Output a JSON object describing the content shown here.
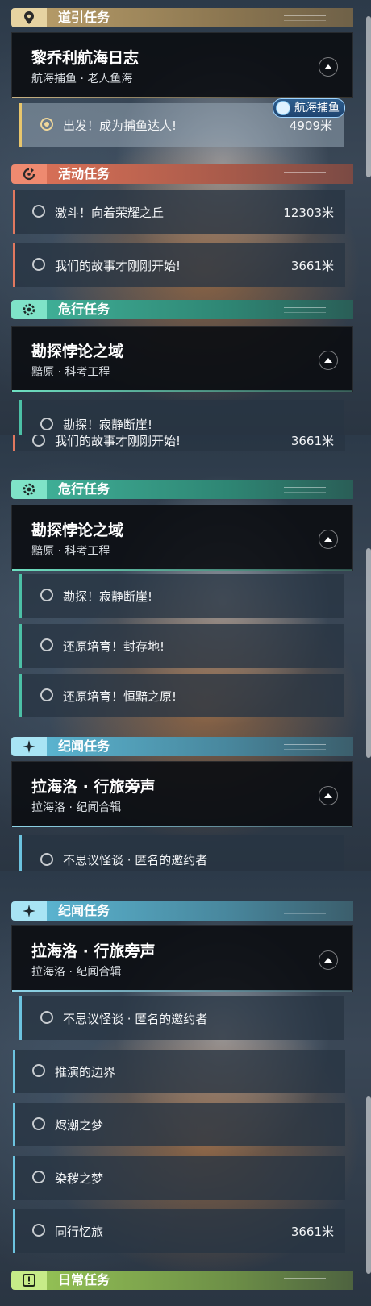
{
  "colors": {
    "guide": "#c9b383",
    "activity": "#e1785f",
    "danger": "#4cc0a6",
    "chronicle": "#6cc3df",
    "daily": "#a8d06a"
  },
  "panel1": {
    "guide": {
      "icon": "map-pin-icon",
      "label": "道引任务",
      "group_title": "黎乔利航海日志",
      "group_sub": "航海捕鱼 · 老人鱼海",
      "tag": "航海捕鱼",
      "task": {
        "name": "出发！成为捕鱼达人!",
        "dist": "4909米"
      }
    },
    "activity": {
      "icon": "refresh-icon",
      "label": "活动任务",
      "tasks": [
        {
          "name": "激斗！向着荣耀之丘",
          "dist": "12303米"
        },
        {
          "name": "我们的故事才刚刚开始!",
          "dist": "3661米"
        }
      ]
    },
    "danger": {
      "icon": "gear-eye-icon",
      "label": "危行任务",
      "group_title": "勘探悖论之域",
      "group_sub": "黯原 · 科考工程",
      "cut_task": "勘探！寂静断崖!"
    }
  },
  "panel2": {
    "cut_task": {
      "name": "我们的故事才刚刚开始!",
      "dist": "3661米"
    },
    "danger": {
      "label": "危行任务",
      "group_title": "勘探悖论之域",
      "group_sub": "黯原 · 科考工程",
      "tasks": [
        {
          "name": "勘探！寂静断崖!"
        },
        {
          "name": "还原培育！封存地!"
        },
        {
          "name": "还原培育！恒黯之原!"
        }
      ]
    },
    "chronicle": {
      "icon": "sparkle-icon",
      "label": "纪闻任务",
      "group_title": "拉海洛 · 行旅旁声",
      "group_sub": "拉海洛 · 纪闻合辑",
      "cut_task": "不思议怪谈 · 匿名的邀约者"
    }
  },
  "panel3": {
    "chronicle": {
      "label": "纪闻任务",
      "group_title": "拉海洛 · 行旅旁声",
      "group_sub": "拉海洛 · 纪闻合辑",
      "sub_task": {
        "name": "不思议怪谈 · 匿名的邀约者"
      },
      "tasks": [
        {
          "name": "推演的边界",
          "dist": ""
        },
        {
          "name": "烬潮之梦",
          "dist": ""
        },
        {
          "name": "染秽之梦",
          "dist": ""
        },
        {
          "name": "同行忆旅",
          "dist": "3661米"
        }
      ]
    },
    "daily": {
      "icon": "alert-icon",
      "label": "日常任务"
    }
  }
}
